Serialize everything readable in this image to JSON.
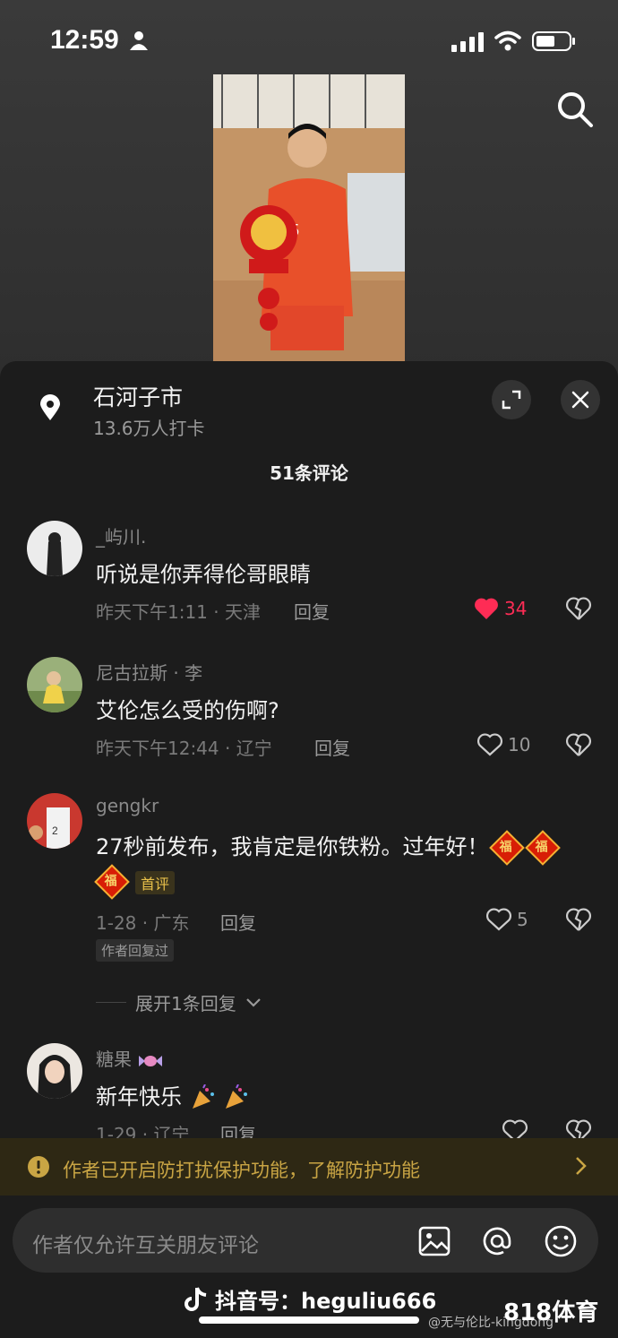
{
  "status_bar": {
    "time": "12:59"
  },
  "location": {
    "name": "石河子市",
    "checkins": "13.6万人打卡"
  },
  "comments_header": {
    "count_label": "51条评论"
  },
  "comments": [
    {
      "user": "_屿川.",
      "text": "听说是你弄得伦哥眼睛",
      "meta": "昨天下午1:11 · 天津",
      "reply": "回复",
      "likes": "34",
      "liked": true
    },
    {
      "user": "尼古拉斯 · 李",
      "text": "艾伦怎么受的伤啊?",
      "meta": "昨天下午12:44 · 辽宁",
      "reply": "回复",
      "likes": "10",
      "liked": false
    },
    {
      "user": "gengkr",
      "text": "27秒前发布，我肯定是你铁粉。过年好！",
      "emoji": "福",
      "tag_first": "首评",
      "meta": "1-28 · 广东",
      "reply": "回复",
      "likes": "5",
      "liked": false,
      "author_tag": "作者回复过",
      "expand": "展开1条回复"
    },
    {
      "user": "糖果",
      "text": "新年快乐",
      "meta": "1-29 · 辽宁",
      "reply": "回复",
      "likes": "",
      "liked": false
    }
  ],
  "notice": {
    "text": "作者已开启防打扰保护功能，了解防护功能"
  },
  "input": {
    "placeholder": "作者仅允许互关朋友评论"
  },
  "watermark": {
    "douyin": "抖音号：heguliu666",
    "weibo": "@无与伦比-kingdong",
    "brand": "818体育"
  },
  "colors": {
    "like_active": "#fe2c55",
    "sheet_bg": "#1c1c1c",
    "notice_text": "#c9a544"
  }
}
